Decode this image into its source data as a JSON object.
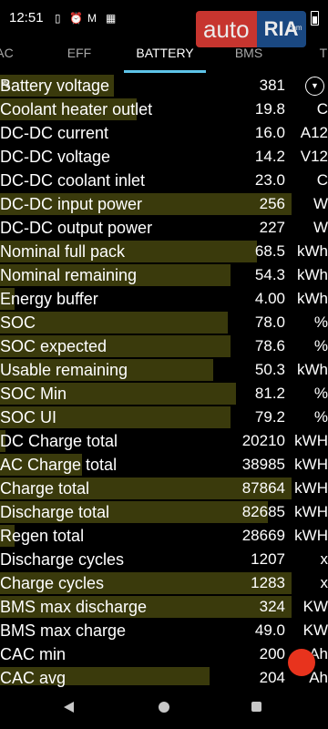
{
  "status_bar": {
    "time": "12:51",
    "icons": [
      "phone-icon",
      "alarm-icon",
      "mail-icon",
      "calendar-icon",
      "battery-icon"
    ]
  },
  "watermark": {
    "brand_left": "auto",
    "brand_right": "RIA",
    "brand_suffix": ".com"
  },
  "tabs": [
    {
      "label": "AC",
      "active": false
    },
    {
      "label": "EFF",
      "active": false
    },
    {
      "label": "BATTERY",
      "active": true
    },
    {
      "label": "BMS",
      "active": false
    },
    {
      "label": "TC",
      "active": false
    }
  ],
  "rows": [
    {
      "name": "Battery voltage",
      "value": "381",
      "unit": "",
      "bar": 0.39
    },
    {
      "name": "Coolant heater outlet",
      "value": "19.8",
      "unit": "C",
      "bar": 0.47
    },
    {
      "name": "DC-DC current",
      "value": "16.0",
      "unit": "A12",
      "bar": 0
    },
    {
      "name": "DC-DC voltage",
      "value": "14.2",
      "unit": "V12",
      "bar": 0
    },
    {
      "name": "DC-DC coolant inlet",
      "value": "23.0",
      "unit": "C",
      "bar": 0
    },
    {
      "name": "DC-DC input power",
      "value": "256",
      "unit": "W",
      "bar": 1.0
    },
    {
      "name": "DC-DC output power",
      "value": "227",
      "unit": "W",
      "bar": 0
    },
    {
      "name": "Nominal full pack",
      "value": "68.5",
      "unit": "kWh",
      "bar": 0.88
    },
    {
      "name": "Nominal remaining",
      "value": "54.3",
      "unit": "kWh",
      "bar": 0.79
    },
    {
      "name": "Energy buffer",
      "value": "4.00",
      "unit": "kWh",
      "bar": 0.05
    },
    {
      "name": "SOC",
      "value": "78.0",
      "unit": "%",
      "bar": 0.78
    },
    {
      "name": "SOC expected",
      "value": "78.6",
      "unit": "%",
      "bar": 0.79
    },
    {
      "name": "Usable remaining",
      "value": "50.3",
      "unit": "kWh",
      "bar": 0.73
    },
    {
      "name": "SOC Min",
      "value": "81.2",
      "unit": "%",
      "bar": 0.81
    },
    {
      "name": "SOC UI",
      "value": "79.2",
      "unit": "%",
      "bar": 0.79
    },
    {
      "name": "DC Charge total",
      "value": "20210",
      "unit": "kWH",
      "bar": 0.02
    },
    {
      "name": "AC Charge total",
      "value": "38985",
      "unit": "kWH",
      "bar": 0.28
    },
    {
      "name": "Charge total",
      "value": "87864",
      "unit": "kWH",
      "bar": 1.0
    },
    {
      "name": "Discharge total",
      "value": "82685",
      "unit": "kWH",
      "bar": 0.92
    },
    {
      "name": "Regen total",
      "value": "28669",
      "unit": "kWH",
      "bar": 0.05
    },
    {
      "name": "Discharge cycles",
      "value": "1207",
      "unit": "x",
      "bar": 0
    },
    {
      "name": "Charge cycles",
      "value": "1283",
      "unit": "x",
      "bar": 1.0
    },
    {
      "name": "BMS max discharge",
      "value": "324",
      "unit": "KW",
      "bar": 1.0
    },
    {
      "name": "BMS max charge",
      "value": "49.0",
      "unit": "KW",
      "bar": 0
    },
    {
      "name": "CAC min",
      "value": "200",
      "unit": "Ah",
      "bar": 0
    },
    {
      "name": "CAC avg",
      "value": "204",
      "unit": "Ah",
      "bar": 0.72
    }
  ],
  "colors": {
    "bar_fill": "#3a3a0c",
    "tab_indicator": "#5ec4e8",
    "fab": "#e8331d"
  }
}
